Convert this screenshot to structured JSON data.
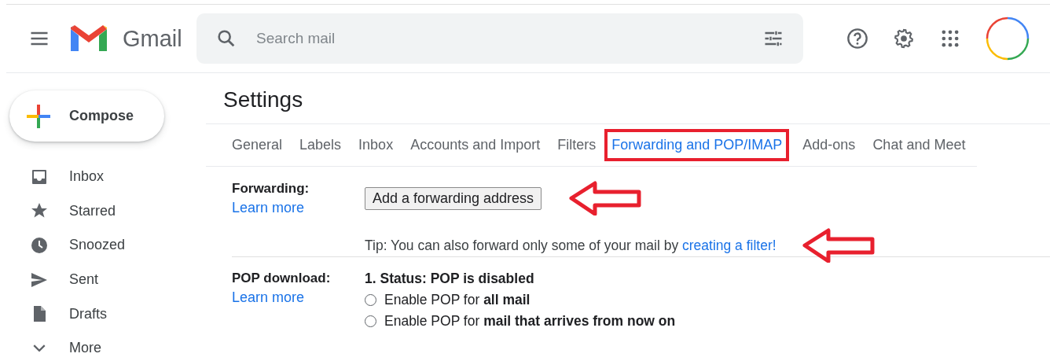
{
  "header": {
    "app_name": "Gmail",
    "search": {
      "placeholder": "Search mail"
    }
  },
  "sidebar": {
    "compose": "Compose",
    "items": [
      {
        "kind": "inbox",
        "label": "Inbox"
      },
      {
        "kind": "star",
        "label": "Starred"
      },
      {
        "kind": "clock",
        "label": "Snoozed"
      },
      {
        "kind": "send",
        "label": "Sent"
      },
      {
        "kind": "file",
        "label": "Drafts"
      },
      {
        "kind": "chevron",
        "label": "More"
      }
    ]
  },
  "settings": {
    "title": "Settings",
    "tabs": [
      {
        "label": "General",
        "selected": false,
        "highlighted": false
      },
      {
        "label": "Labels",
        "selected": false,
        "highlighted": false
      },
      {
        "label": "Inbox",
        "selected": false,
        "highlighted": false
      },
      {
        "label": "Accounts and Import",
        "selected": false,
        "highlighted": false
      },
      {
        "label": "Filters",
        "selected": false,
        "highlighted": false
      },
      {
        "label": "Forwarding and POP/IMAP",
        "selected": true,
        "highlighted": true
      },
      {
        "label": "Add-ons",
        "selected": false,
        "highlighted": false
      },
      {
        "label": "Chat and Meet",
        "selected": false,
        "highlighted": false
      }
    ],
    "forwarding": {
      "label": "Forwarding:",
      "learn_more": "Learn more",
      "button": "Add a forwarding address",
      "button_annotated": true,
      "tip": "Tip: You can also forward only some of your mail by ",
      "tip_link": "creating a filter!",
      "tip_annotated": true
    },
    "pop": {
      "label": "POP download:",
      "learn_more": "Learn more",
      "status": "1. Status: POP is disabled",
      "options": [
        {
          "label": "Enable POP for **all mail**",
          "selected": false
        },
        {
          "label": "Enable POP for **mail that arrives from now on**",
          "selected": false
        }
      ]
    }
  }
}
